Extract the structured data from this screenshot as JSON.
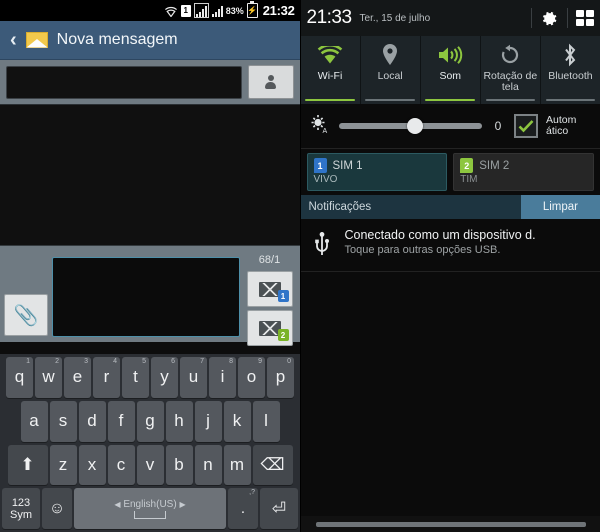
{
  "left_panel": {
    "statusbar": {
      "wifi_icon": "wifi-icon",
      "sim_indicator": "1",
      "signal_icon_1": "signal-bars-icon",
      "signal_icon_2": "signal-bars-icon",
      "battery_percent": "83%",
      "battery_icon": "battery-charging-icon",
      "time": "21:32"
    },
    "appbar": {
      "back_icon": "back-chevron-icon",
      "app_icon": "envelope-icon",
      "title": "Nova mensagem"
    },
    "recipient": {
      "input_value": "",
      "placeholder": "",
      "contacts_icon": "contact-person-icon"
    },
    "composer": {
      "attach_icon": "paperclip-icon",
      "message_value": "",
      "message_placeholder": "",
      "counter": "68/1",
      "send_sim1_icon": "send-envelope-icon",
      "send_sim1_badge": "1",
      "send_sim2_icon": "send-envelope-icon",
      "send_sim2_badge": "2"
    },
    "keyboard": {
      "row1": [
        {
          "key": "q",
          "num": "1"
        },
        {
          "key": "w",
          "num": "2"
        },
        {
          "key": "e",
          "num": "3"
        },
        {
          "key": "r",
          "num": "4"
        },
        {
          "key": "t",
          "num": "5"
        },
        {
          "key": "y",
          "num": "6"
        },
        {
          "key": "u",
          "num": "7"
        },
        {
          "key": "i",
          "num": "8"
        },
        {
          "key": "o",
          "num": "9"
        },
        {
          "key": "p",
          "num": "0"
        }
      ],
      "row2": [
        {
          "key": "a"
        },
        {
          "key": "s"
        },
        {
          "key": "d"
        },
        {
          "key": "f"
        },
        {
          "key": "g"
        },
        {
          "key": "h"
        },
        {
          "key": "j"
        },
        {
          "key": "k"
        },
        {
          "key": "l"
        }
      ],
      "row3": [
        {
          "key": "z"
        },
        {
          "key": "x"
        },
        {
          "key": "c"
        },
        {
          "key": "v"
        },
        {
          "key": "b"
        },
        {
          "key": "n"
        },
        {
          "key": "m"
        }
      ],
      "shift_icon": "shift-arrow-icon",
      "backspace_icon": "backspace-icon",
      "sym_label_top": "123",
      "sym_label_bottom": "Sym",
      "emoji_icon": "emoji-smiley-icon",
      "space_label": "English(US)",
      "space_left_arrow": "◀",
      "space_right_arrow": "▶",
      "period_label": ".",
      "period_sup": ",?",
      "enter_icon": "enter-return-icon"
    }
  },
  "right_panel": {
    "shade_header": {
      "time": "21:33",
      "date": "Ter., 15 de julho",
      "settings_icon": "gear-icon",
      "quick_toggle_icon": "quick-settings-grid-icon"
    },
    "quick_toggles": [
      {
        "label": "Wi-Fi",
        "icon": "wifi-icon",
        "active": true
      },
      {
        "label": "Local",
        "icon": "location-pin-icon",
        "active": false
      },
      {
        "label": "Som",
        "icon": "sound-speaker-icon",
        "active": true
      },
      {
        "label": "Rotação de tela",
        "icon": "screen-rotation-icon",
        "active": false
      },
      {
        "label": "Bluetooth",
        "icon": "bluetooth-icon",
        "active": false
      }
    ],
    "brightness": {
      "icon": "brightness-auto-icon",
      "value": "0",
      "slider_percent": 48,
      "auto_label_line1": "Autom",
      "auto_label_line2": "ático",
      "auto_checked": true,
      "check_icon": "checkmark-icon"
    },
    "sims": [
      {
        "badge": "1",
        "name": "SIM 1",
        "carrier": "VIVO",
        "active": true
      },
      {
        "badge": "2",
        "name": "SIM 2",
        "carrier": "TIM",
        "active": false
      }
    ],
    "notifications": {
      "header": "Notificações",
      "clear_label": "Limpar",
      "items": [
        {
          "icon": "usb-icon",
          "title": "Conectado como um dispositivo d.",
          "subtitle": "Toque para outras opções USB."
        }
      ]
    },
    "handle_icon": "shade-drag-handle"
  },
  "colors": {
    "appbar": "#3c5a79",
    "accent_green": "#8dc63f",
    "sim1_blue": "#2f74c8",
    "clear_button": "#4a7c9b",
    "notif_header": "#1d3440"
  }
}
